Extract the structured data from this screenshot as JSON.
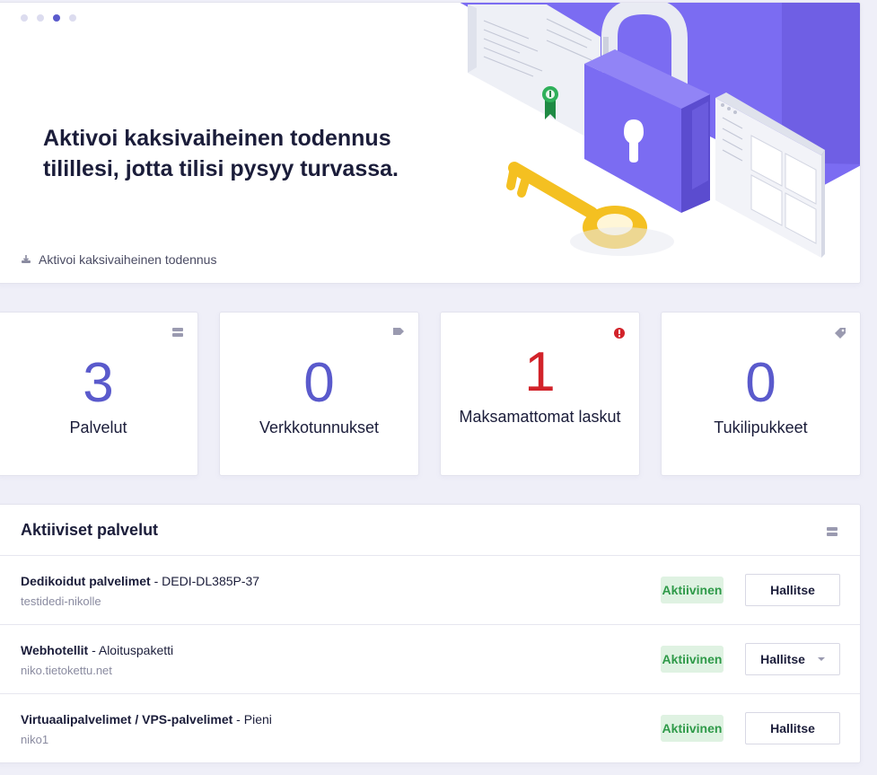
{
  "hero": {
    "title": "Aktivoi kaksivaiheinen todennus tilillesi, jotta tilisi pysyy turvassa.",
    "link_label": "Aktivoi kaksivaiheinen todennus",
    "carousel_pages": 4,
    "carousel_active": 3,
    "accent": "#7b6cf2"
  },
  "stats": [
    {
      "value": "3",
      "label": "Palvelut",
      "icon": "server-icon"
    },
    {
      "value": "0",
      "label": "Verkkotunnukset",
      "icon": "tag-icon"
    },
    {
      "value": "1",
      "label": "Maksamattomat laskut",
      "icon": "alert-icon"
    },
    {
      "value": "0",
      "label": "Tukilipukkeet",
      "icon": "ticket-icon"
    }
  ],
  "services": {
    "title": "Aktiiviset palvelut",
    "rows": [
      {
        "product": "Dedikoidut palvelimet",
        "plan": "DEDI-DL385P-37",
        "host": "testidedi-nikolle",
        "status": "Aktiivinen",
        "action": "Hallitse"
      },
      {
        "product": "Webhotellit",
        "plan": "Aloituspaketti",
        "host": "niko.tietokettu.net",
        "status": "Aktiivinen",
        "action": "Hallitse"
      },
      {
        "product": "Virtuaalipalvelimet / VPS-palvelimet",
        "plan": "Pieni",
        "host": "niko1",
        "status": "Aktiivinen",
        "action": "Hallitse"
      }
    ]
  },
  "colors": {
    "primary": "#5a5acc",
    "danger": "#d2232a",
    "success_bg": "#dff2e2",
    "success_text": "#2f9a49"
  }
}
